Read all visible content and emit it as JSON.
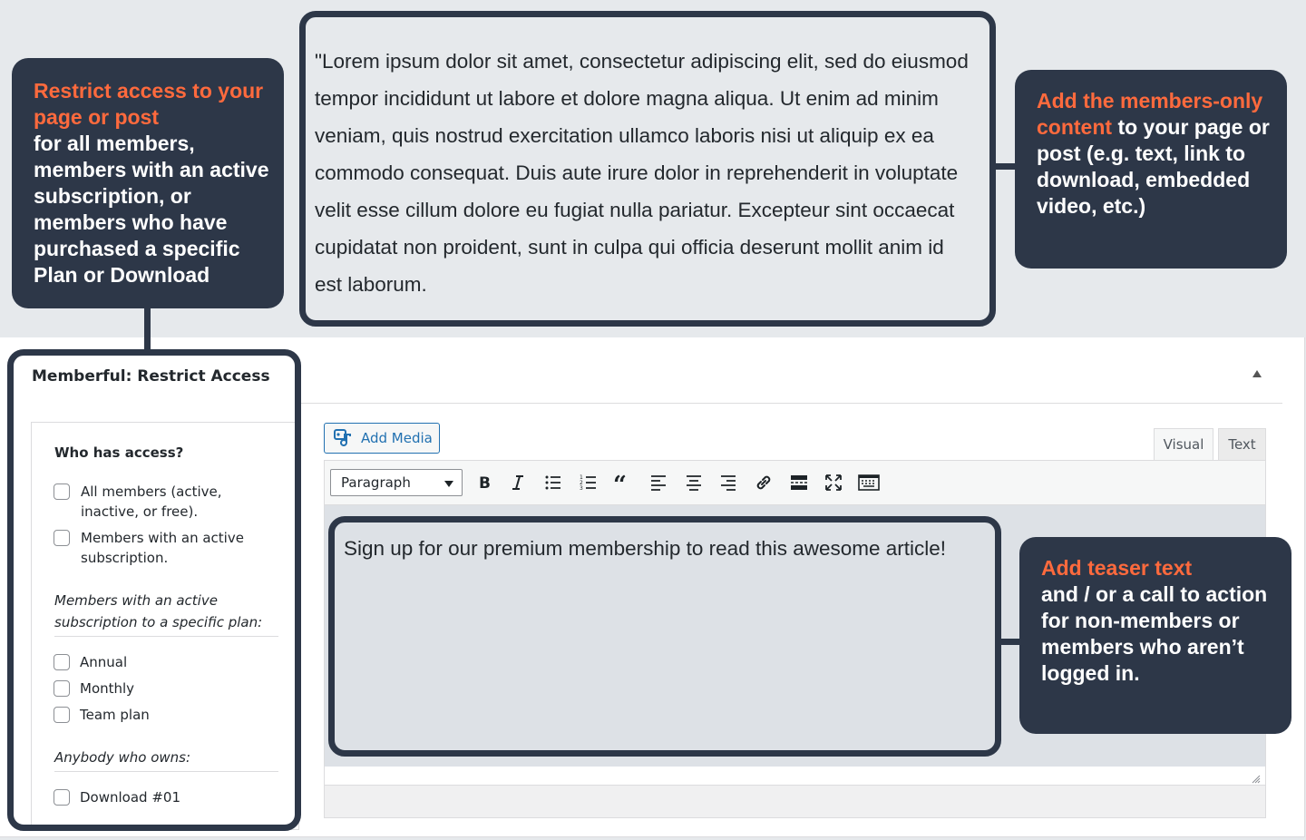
{
  "callouts": {
    "restrict": {
      "accent": "Restrict access to your page or post",
      "body": "for all members, members with an active subscription, or members who have purchased a specific Plan or Download"
    },
    "members_only": {
      "accent": "Add the members-only content",
      "body": " to your page or post (e.g. text, link to download, embedded video, etc.)"
    },
    "teaser": {
      "accent": "Add teaser text",
      "body": "and / or a call to action for non-members or members who aren’t logged in."
    }
  },
  "lorem": "\"Lorem ipsum dolor sit amet, consectetur adipiscing elit, sed do eiusmod tempor incididunt ut labore et dolore magna aliqua. Ut enim ad minim veniam, quis nostrud exercitation ullamco laboris nisi ut aliquip ex ea commodo consequat. Duis aute irure dolor in reprehenderit in voluptate velit esse cillum dolore eu fugiat nulla pariatur. Excepteur sint occaecat cupidatat non proident, sunt in culpa qui officia deserunt mollit anim id est laborum.",
  "panel": {
    "title": "Memberful: Restrict Access"
  },
  "access": {
    "label": "Who has access?",
    "options": [
      {
        "label": "All members (active, inactive, or free).",
        "checked": false
      },
      {
        "label": "Members with an active subscription.",
        "checked": false
      }
    ],
    "plans_label": "Members with an active subscription to a specific plan:",
    "plans": [
      {
        "label": "Annual",
        "checked": false
      },
      {
        "label": "Monthly",
        "checked": false
      },
      {
        "label": "Team plan",
        "checked": false
      }
    ],
    "downloads_label": "Anybody who owns:",
    "downloads": [
      {
        "label": "Download #01",
        "checked": false
      }
    ]
  },
  "editor": {
    "add_media": "Add Media",
    "tabs": {
      "visual": "Visual",
      "text": "Text"
    },
    "format": "Paragraph",
    "teaser_text": "Sign up for our premium membership to read this awesome article!"
  },
  "colors": {
    "accent": "#ff6a3d",
    "callout_bg": "#2d3748",
    "link_blue": "#2271b1"
  }
}
